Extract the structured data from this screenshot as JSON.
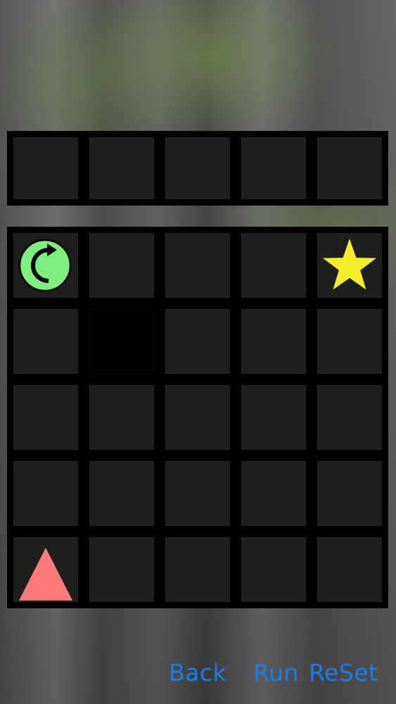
{
  "background": {
    "theme": "misty forest"
  },
  "colors": {
    "grid": "#000000",
    "rotate_piece": "#7eee7e",
    "goal_star": "#f5ee2a",
    "player_triangle": "#ff7b7b",
    "button_text": "#1a7de8"
  },
  "command_bar": {
    "slots": 5,
    "filled": []
  },
  "board": {
    "rows": 5,
    "cols": 5,
    "walls": [
      [
        1,
        1
      ]
    ],
    "rotate_piece": {
      "row": 0,
      "col": 0,
      "icon": "clockwise-rotate-icon"
    },
    "goal": {
      "row": 0,
      "col": 4,
      "icon": "star-icon"
    },
    "player": {
      "row": 4,
      "col": 0,
      "icon": "triangle-icon",
      "facing": "up"
    }
  },
  "buttons": {
    "back": "Back",
    "run": "Run",
    "reset": "ReSet"
  }
}
